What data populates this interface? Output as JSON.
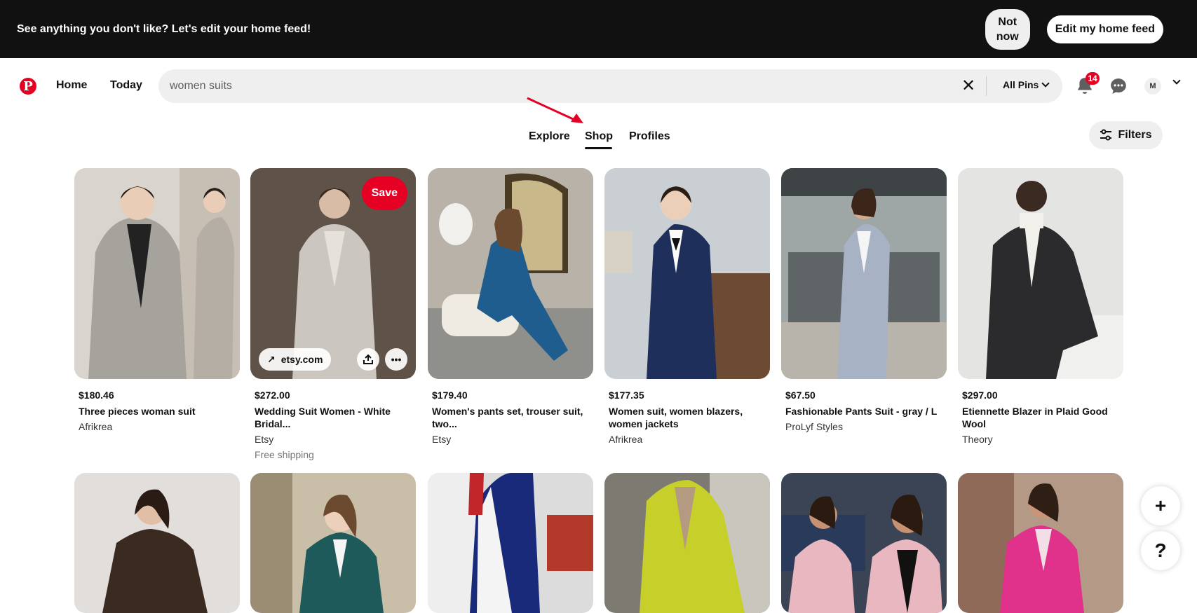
{
  "banner": {
    "text": "See anything you don't like? Let's edit your home feed!",
    "not_now": "Not\nnow",
    "edit_feed": "Edit my home feed"
  },
  "nav": {
    "home": "Home",
    "today": "Today"
  },
  "search": {
    "value": "women suits",
    "clear_icon": "close-icon",
    "pin_filter": "All Pins"
  },
  "notifications": {
    "count": "14"
  },
  "account": {
    "initial": "M"
  },
  "tabs": {
    "explore": "Explore",
    "shop": "Shop",
    "profiles": "Profiles",
    "active": "Shop"
  },
  "filters": {
    "label": "Filters"
  },
  "pins_row1": [
    {
      "price": "$180.46",
      "title": "Three pieces woman suit",
      "seller": "Afrikrea"
    },
    {
      "price": "$272.00",
      "title": "Wedding Suit Women - White Bridal...",
      "seller": "Etsy",
      "shipping": "Free shipping",
      "save_label": "Save",
      "link": "etsy.com"
    },
    {
      "price": "$179.40",
      "title": "Women's pants set, trouser suit, two...",
      "seller": "Etsy"
    },
    {
      "price": "$177.35",
      "title": "Women suit, women blazers, women jackets",
      "seller": "Afrikrea"
    },
    {
      "price": "$67.50",
      "title": "Fashionable Pants Suit - gray / L",
      "seller": "ProLyf Styles"
    },
    {
      "price": "$297.00",
      "title": "Etiennette Blazer in Plaid Good Wool",
      "seller": "Theory"
    }
  ],
  "colors": {
    "brand": "#e60023",
    "banner_bg": "#111111",
    "search_bg": "#efefef"
  },
  "floating": {
    "add": "+",
    "help": "?"
  }
}
